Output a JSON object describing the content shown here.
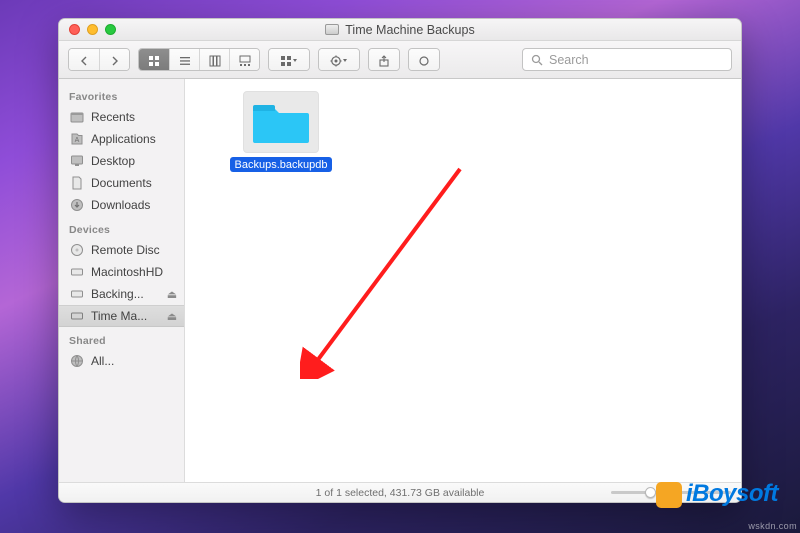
{
  "window": {
    "title": "Time Machine Backups"
  },
  "toolbar": {
    "search_placeholder": "Search"
  },
  "sidebar": {
    "sections": {
      "favorites": "Favorites",
      "devices": "Devices",
      "shared": "Shared"
    },
    "favorites_items": [
      {
        "label": "Recents"
      },
      {
        "label": "Applications"
      },
      {
        "label": "Desktop"
      },
      {
        "label": "Documents"
      },
      {
        "label": "Downloads"
      }
    ],
    "devices_items": [
      {
        "label": "Remote Disc",
        "ejectable": false
      },
      {
        "label": "MacintoshHD",
        "ejectable": false
      },
      {
        "label": "Backing...",
        "ejectable": true
      },
      {
        "label": "Time Ma...",
        "ejectable": true,
        "selected": true
      }
    ],
    "shared_items": [
      {
        "label": "All..."
      }
    ]
  },
  "content": {
    "items": [
      {
        "label": "Backups.backupdb"
      }
    ]
  },
  "statusbar": {
    "text": "1 of 1 selected, 431.73 GB available"
  },
  "watermark": {
    "brand": "iBoysoft",
    "domain": "wskdn.com"
  }
}
